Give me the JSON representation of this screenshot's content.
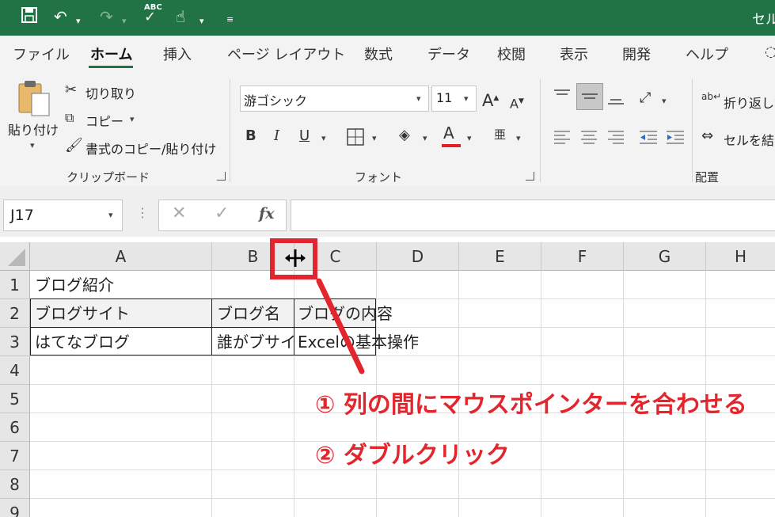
{
  "app": {
    "title_partial": "セル"
  },
  "quick_access": {
    "spell_label": "ABC"
  },
  "tabs": [
    "ファイル",
    "ホーム",
    "挿入",
    "ページ レイアウト",
    "数式",
    "データ",
    "校閲",
    "表示",
    "開発",
    "ヘルプ"
  ],
  "ribbon": {
    "clipboard": {
      "paste_label": "貼り付け",
      "cut_label": "切り取り",
      "copy_label": "コピー",
      "format_painter_label": "書式のコピー/貼り付け",
      "group_label": "クリップボード"
    },
    "font": {
      "font_name": "游ゴシック",
      "font_size": "11",
      "bold": "B",
      "italic": "I",
      "underline": "U",
      "font_color_glyph": "A",
      "grow_glyph": "A",
      "shrink_glyph": "A",
      "group_label": "フォント"
    },
    "alignment": {
      "wrap_label": "折り返して",
      "merge_label": "セルを結合",
      "group_label": "配置"
    }
  },
  "formula_bar": {
    "name_box": "J17",
    "fx_label": "fx",
    "formula": ""
  },
  "grid": {
    "columns": [
      "A",
      "B",
      "C",
      "D",
      "E",
      "F",
      "G",
      "H"
    ],
    "rows": [
      "1",
      "2",
      "3",
      "4",
      "5",
      "6",
      "7",
      "8",
      "9"
    ],
    "cells": {
      "A1": "ブログ紹介",
      "A2": "ブログサイト",
      "B2": "ブログ名",
      "C2": "ブログの内容",
      "A3": "はてなブログ",
      "B3": "誰がブサイ",
      "C3": "Excelの基本操作"
    }
  },
  "annotation": {
    "step1": "① 列の間にマウスポインターを合わせる",
    "step2": "② ダブルクリック",
    "color": "#e3262e"
  },
  "colors": {
    "excel_green": "#217346",
    "font_color_bar": "#e02020"
  }
}
